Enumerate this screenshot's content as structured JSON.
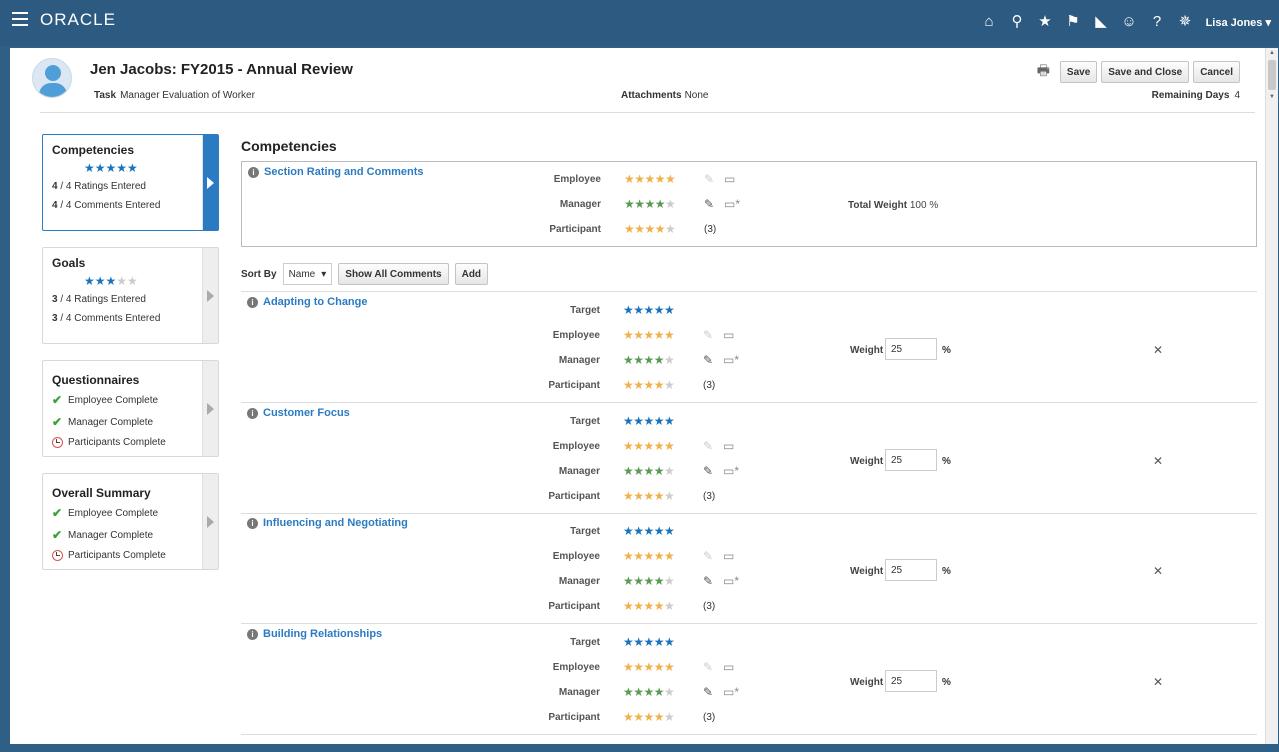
{
  "topbar": {
    "logo": "ORACLE",
    "icons": [
      "home-icon",
      "search-icon",
      "star-icon",
      "flag-icon",
      "bell-icon",
      "accessibility-icon",
      "help-icon",
      "settings-icon"
    ],
    "user": "Lisa Jones"
  },
  "header": {
    "title": "Jen Jacobs: FY2015 - Annual Review",
    "task_label": "Task",
    "task_value": "Manager Evaluation of Worker",
    "attachments_label": "Attachments",
    "attachments_value": "None",
    "remaining_label": "Remaining Days",
    "remaining_value": "4",
    "buttons": {
      "save": "Save",
      "save_close": "Save and Close",
      "cancel": "Cancel"
    }
  },
  "nav": {
    "competencies": {
      "title": "Competencies",
      "rating": 5,
      "ratings_done": "4",
      "ratings_text": "/ 4 Ratings Entered",
      "comments_done": "4",
      "comments_text": "/ 4 Comments Entered"
    },
    "goals": {
      "title": "Goals",
      "rating": 3,
      "ratings_done": "3",
      "ratings_text": "/ 4 Ratings Entered",
      "comments_done": "3",
      "comments_text": "/ 4 Comments Entered"
    },
    "questionnaires": {
      "title": "Questionnaires",
      "items": [
        "Employee Complete",
        "Manager Complete",
        "Participants Complete"
      ]
    },
    "overall": {
      "title": "Overall Summary",
      "items": [
        "Employee Complete",
        "Manager Complete",
        "Participants Complete"
      ]
    }
  },
  "content": {
    "title": "Competencies",
    "section": {
      "link": "Section Rating and Comments",
      "employee_label": "Employee",
      "manager_label": "Manager",
      "participant_label": "Participant",
      "participant_count": "(3)",
      "total_weight_label": "Total Weight",
      "total_weight_value": "100 %"
    },
    "sort": {
      "label": "Sort By",
      "value": "Name",
      "show_all": "Show All Comments",
      "add": "Add"
    },
    "row_labels": {
      "target": "Target",
      "employee": "Employee",
      "manager": "Manager",
      "participant": "Participant",
      "weight": "Weight",
      "pct": "%"
    },
    "competencies": [
      {
        "name": "Adapting to Change",
        "weight": "25",
        "target": 5,
        "employee": 5,
        "manager": 4,
        "participant": 4,
        "count": "(3)"
      },
      {
        "name": "Customer Focus",
        "weight": "25",
        "target": 5,
        "employee": 5,
        "manager": 4,
        "participant": 4,
        "count": "(3)"
      },
      {
        "name": "Influencing and Negotiating",
        "weight": "25",
        "target": 5,
        "employee": 5,
        "manager": 4,
        "participant": 4,
        "count": "(3)"
      },
      {
        "name": "Building Relationships",
        "weight": "25",
        "target": 5,
        "employee": 5,
        "manager": 4,
        "participant": 4,
        "count": "(3)"
      }
    ]
  },
  "colors": {
    "brand": "#2c5a80",
    "accent": "#2b7bc3",
    "employee_star": "#f0b14a",
    "manager_star": "#5a9a53",
    "target_star": "#1a73bd"
  }
}
